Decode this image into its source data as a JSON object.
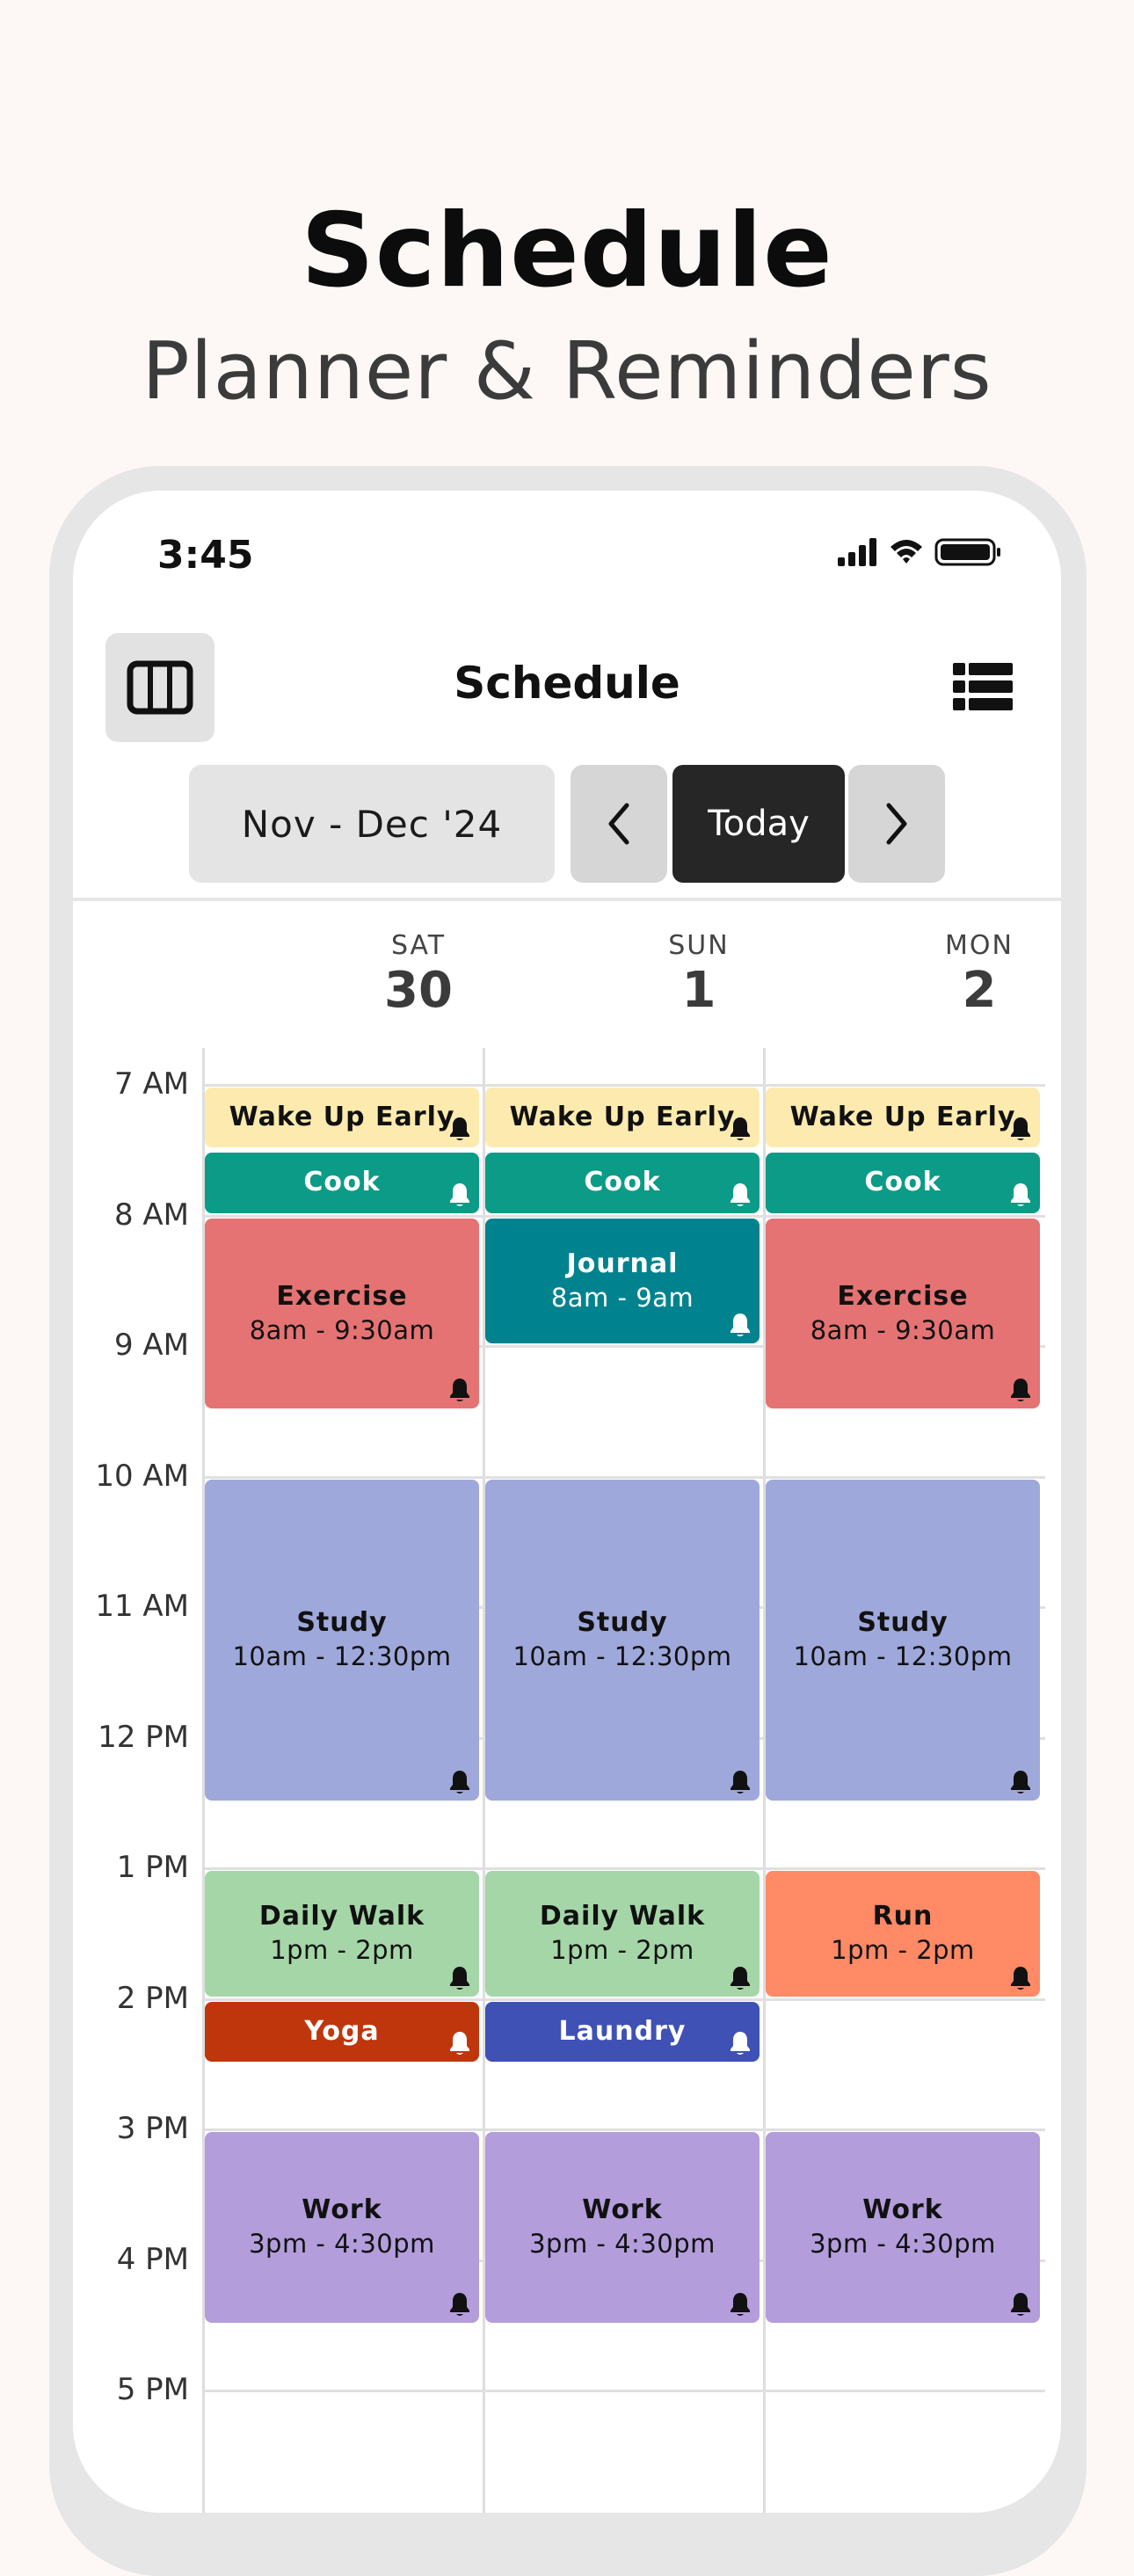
{
  "hero": {
    "title": "Schedule",
    "subtitle": "Planner & Reminders"
  },
  "status_bar": {
    "time": "3:45"
  },
  "header": {
    "title": "Schedule"
  },
  "nav": {
    "range_label": "Nov - Dec '24",
    "today_label": "Today"
  },
  "days": [
    {
      "name": "SAT",
      "number": "30"
    },
    {
      "name": "SUN",
      "number": "1"
    },
    {
      "name": "MON",
      "number": "2"
    }
  ],
  "hours": [
    "7 AM",
    "8 AM",
    "9 AM",
    "10 AM",
    "11 AM",
    "12 PM",
    "1 PM",
    "2 PM",
    "3 PM",
    "4 PM",
    "5 PM"
  ],
  "events": [
    {
      "day": 0,
      "title": "Wake Up Early",
      "time": "",
      "start": 7.0,
      "end": 7.5,
      "color": "#fdeaae",
      "text_color": "#111111",
      "bell": "#111111"
    },
    {
      "day": 1,
      "title": "Wake Up Early",
      "time": "",
      "start": 7.0,
      "end": 7.5,
      "color": "#fdeaae",
      "text_color": "#111111",
      "bell": "#111111"
    },
    {
      "day": 2,
      "title": "Wake Up Early",
      "time": "",
      "start": 7.0,
      "end": 7.5,
      "color": "#fdeaae",
      "text_color": "#111111",
      "bell": "#111111"
    },
    {
      "day": 0,
      "title": "Cook",
      "time": "",
      "start": 7.5,
      "end": 8.0,
      "color": "#0b9b86",
      "text_color": "#ffffff",
      "bell": "#ffffff"
    },
    {
      "day": 1,
      "title": "Cook",
      "time": "",
      "start": 7.5,
      "end": 8.0,
      "color": "#0b9b86",
      "text_color": "#ffffff",
      "bell": "#ffffff"
    },
    {
      "day": 2,
      "title": "Cook",
      "time": "",
      "start": 7.5,
      "end": 8.0,
      "color": "#0b9b86",
      "text_color": "#ffffff",
      "bell": "#ffffff"
    },
    {
      "day": 0,
      "title": "Exercise",
      "time": "8am - 9:30am",
      "start": 8.0,
      "end": 9.5,
      "color": "#e57373",
      "text_color": "#111111",
      "bell": "#111111"
    },
    {
      "day": 1,
      "title": "Journal",
      "time": "8am - 9am",
      "start": 8.0,
      "end": 9.0,
      "color": "#00838f",
      "text_color": "#ffffff",
      "bell": "#ffffff"
    },
    {
      "day": 2,
      "title": "Exercise",
      "time": "8am - 9:30am",
      "start": 8.0,
      "end": 9.5,
      "color": "#e57373",
      "text_color": "#111111",
      "bell": "#111111"
    },
    {
      "day": 0,
      "title": "Study",
      "time": "10am - 12:30pm",
      "start": 10.0,
      "end": 12.5,
      "color": "#9fa8da",
      "text_color": "#111111",
      "bell": "#111111"
    },
    {
      "day": 1,
      "title": "Study",
      "time": "10am - 12:30pm",
      "start": 10.0,
      "end": 12.5,
      "color": "#9fa8da",
      "text_color": "#111111",
      "bell": "#111111"
    },
    {
      "day": 2,
      "title": "Study",
      "time": "10am - 12:30pm",
      "start": 10.0,
      "end": 12.5,
      "color": "#9fa8da",
      "text_color": "#111111",
      "bell": "#111111"
    },
    {
      "day": 0,
      "title": "Daily Walk",
      "time": "1pm - 2pm",
      "start": 13.0,
      "end": 14.0,
      "color": "#a5d6a7",
      "text_color": "#111111",
      "bell": "#111111"
    },
    {
      "day": 1,
      "title": "Daily Walk",
      "time": "1pm - 2pm",
      "start": 13.0,
      "end": 14.0,
      "color": "#a5d6a7",
      "text_color": "#111111",
      "bell": "#111111"
    },
    {
      "day": 2,
      "title": "Run",
      "time": "1pm - 2pm",
      "start": 13.0,
      "end": 14.0,
      "color": "#ff8a65",
      "text_color": "#111111",
      "bell": "#111111"
    },
    {
      "day": 0,
      "title": "Yoga",
      "time": "",
      "start": 14.0,
      "end": 14.5,
      "color": "#bf360c",
      "text_color": "#ffffff",
      "bell": "#ffffff"
    },
    {
      "day": 1,
      "title": "Laundry",
      "time": "",
      "start": 14.0,
      "end": 14.5,
      "color": "#3f51b5",
      "text_color": "#ffffff",
      "bell": "#ffffff"
    },
    {
      "day": 0,
      "title": "Work",
      "time": "3pm - 4:30pm",
      "start": 15.0,
      "end": 16.5,
      "color": "#b39ddb",
      "text_color": "#111111",
      "bell": "#111111"
    },
    {
      "day": 1,
      "title": "Work",
      "time": "3pm - 4:30pm",
      "start": 15.0,
      "end": 16.5,
      "color": "#b39ddb",
      "text_color": "#111111",
      "bell": "#111111"
    },
    {
      "day": 2,
      "title": "Work",
      "time": "3pm - 4:30pm",
      "start": 15.0,
      "end": 16.5,
      "color": "#b39ddb",
      "text_color": "#111111",
      "bell": "#111111"
    }
  ]
}
